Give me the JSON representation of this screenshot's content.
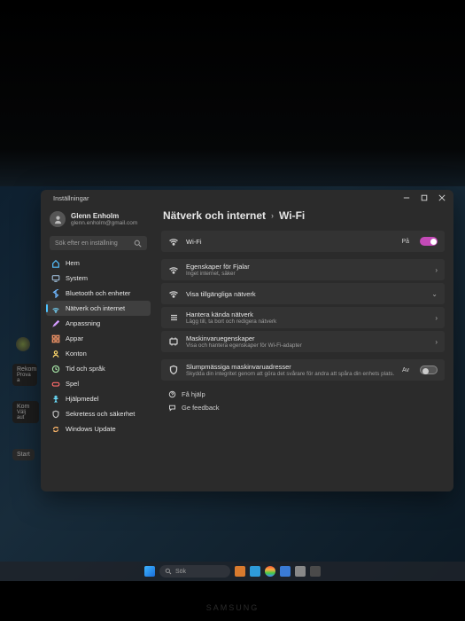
{
  "window": {
    "title": "Inställningar",
    "account": {
      "name": "Glenn Enholm",
      "email": "glenn.enholm@gmail.com"
    },
    "search_placeholder": "Sök efter en inställning"
  },
  "sidebar": {
    "items": [
      {
        "label": "Hem"
      },
      {
        "label": "System"
      },
      {
        "label": "Bluetooth och enheter"
      },
      {
        "label": "Nätverk och internet"
      },
      {
        "label": "Anpassning"
      },
      {
        "label": "Appar"
      },
      {
        "label": "Konton"
      },
      {
        "label": "Tid och språk"
      },
      {
        "label": "Spel"
      },
      {
        "label": "Hjälpmedel"
      },
      {
        "label": "Sekretess och säkerhet"
      },
      {
        "label": "Windows Update"
      }
    ]
  },
  "breadcrumb": {
    "parent": "Nätverk och internet",
    "current": "Wi-Fi"
  },
  "rows": {
    "wifi": {
      "title": "Wi-Fi",
      "state": "På"
    },
    "props": {
      "title": "Egenskaper för Fjalar",
      "sub": "Inget internet, säker"
    },
    "avail": {
      "title": "Visa tillgängliga nätverk"
    },
    "known": {
      "title": "Hantera kända nätverk",
      "sub": "Lägg till, ta bort och redigera nätverk"
    },
    "hw": {
      "title": "Maskinvaruegenskaper",
      "sub": "Visa och hantera egenskaper för Wi-Fi-adapter"
    },
    "random": {
      "title": "Slumpmässiga maskinvaruadresser",
      "sub": "Skydda din integritet genom att göra det svårare för andra att spåra din enhets plats.",
      "state": "Av"
    }
  },
  "help": {
    "get": "Få hjälp",
    "fb": "Ge feedback"
  },
  "taskbar": {
    "search": "Sök"
  },
  "bg": {
    "rekom": "Rekom",
    "prova": "Prova a",
    "kom": "Kom",
    "valj": "Välj",
    "aut": "aut",
    "start": "Start"
  },
  "brand": "SAMSUNG"
}
